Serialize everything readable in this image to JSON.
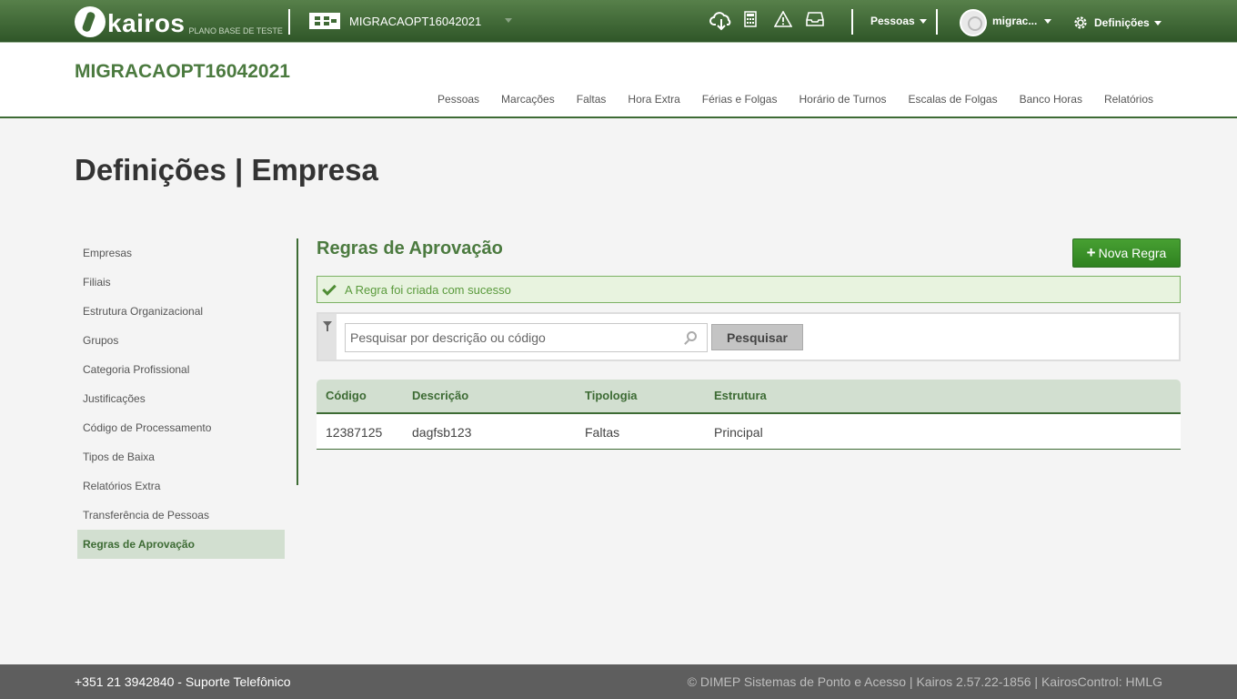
{
  "topbar": {
    "brand": "kairos",
    "brand_subtitle": "PLANO BASE DE TESTE",
    "company_selector": "MIGRACAOPT16042021",
    "menu_people": "Pessoas",
    "user_name": "migrac...",
    "menu_settings": "Definições",
    "icons": [
      "cloud-download-icon",
      "calculator-icon",
      "warning-icon",
      "inbox-icon",
      "gear-icon"
    ]
  },
  "header": {
    "company_title": "MIGRACAOPT16042021",
    "nav": [
      "Pessoas",
      "Marcações",
      "Faltas",
      "Hora Extra",
      "Férias e Folgas",
      "Horário de Turnos",
      "Escalas de Folgas",
      "Banco Horas",
      "Relatórios"
    ]
  },
  "page": {
    "title": "Definições | Empresa"
  },
  "sidebar": {
    "items": [
      {
        "label": "Empresas"
      },
      {
        "label": "Filiais"
      },
      {
        "label": "Estrutura Organizacional"
      },
      {
        "label": "Grupos"
      },
      {
        "label": "Categoria Profissional"
      },
      {
        "label": "Justificações"
      },
      {
        "label": "Código de Processamento"
      },
      {
        "label": "Tipos de Baixa"
      },
      {
        "label": "Relatórios Extra"
      },
      {
        "label": "Transferência de Pessoas"
      },
      {
        "label": "Regras de Aprovação"
      }
    ],
    "active_index": 10
  },
  "content": {
    "section_title": "Regras de Aprovação",
    "new_button_label": "Nova Regra",
    "alert_message": "A Regra foi criada com sucesso",
    "search": {
      "placeholder": "Pesquisar por descrição ou código",
      "value": "",
      "button_label": "Pesquisar"
    },
    "table": {
      "headers": [
        "Código",
        "Descrição",
        "Tipologia",
        "Estrutura"
      ],
      "rows": [
        [
          "12387125",
          "dagfsb123",
          "Faltas",
          "Principal"
        ]
      ]
    }
  },
  "footer": {
    "support": "+351 21 3942840 - Suporte Telefônico",
    "copyright": "© DIMEP Sistemas de Ponto e Acesso | Kairos 2.57.22-1856 | KairosControl: HMLG"
  },
  "colors": {
    "brand_green": "#3d6b34",
    "title_green": "#4b7a3f",
    "success_bg": "#e8f3df",
    "button_green": "#3a922a"
  }
}
